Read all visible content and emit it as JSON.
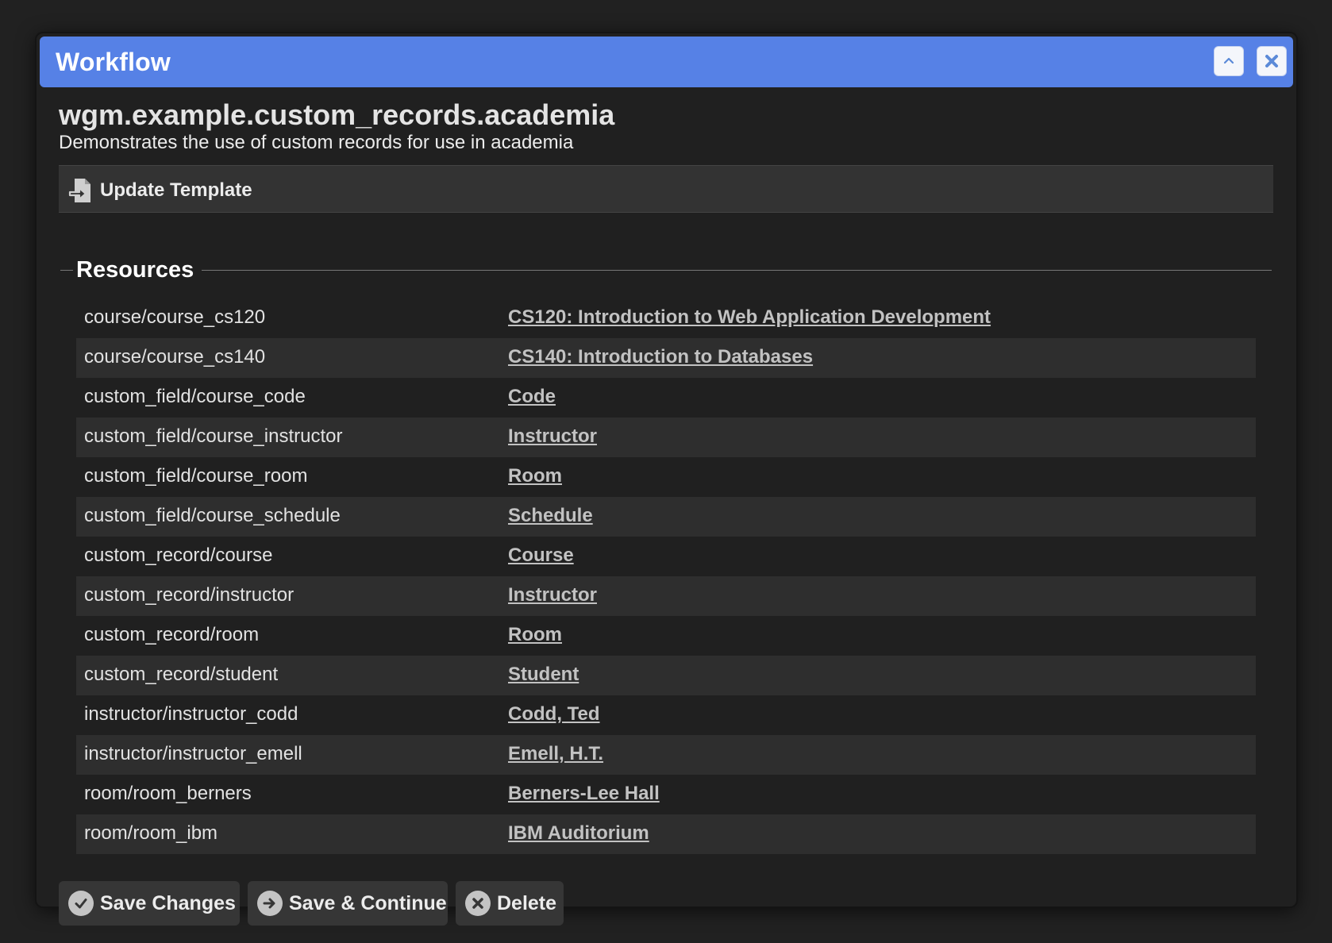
{
  "window": {
    "title": "Workflow"
  },
  "header": {
    "title": "wgm.example.custom_records.academia",
    "description": "Demonstrates the use of custom records for use in academia"
  },
  "toolbar": {
    "update_template_label": "Update Template"
  },
  "resources": {
    "title": "Resources",
    "rows": [
      {
        "key": "course/course_cs120",
        "value": "CS120: Introduction to Web Application Development"
      },
      {
        "key": "course/course_cs140",
        "value": "CS140: Introduction to Databases"
      },
      {
        "key": "custom_field/course_code",
        "value": "Code"
      },
      {
        "key": "custom_field/course_instructor",
        "value": "Instructor"
      },
      {
        "key": "custom_field/course_room",
        "value": "Room"
      },
      {
        "key": "custom_field/course_schedule",
        "value": "Schedule"
      },
      {
        "key": "custom_record/course",
        "value": "Course"
      },
      {
        "key": "custom_record/instructor",
        "value": "Instructor"
      },
      {
        "key": "custom_record/room",
        "value": "Room"
      },
      {
        "key": "custom_record/student",
        "value": "Student"
      },
      {
        "key": "instructor/instructor_codd",
        "value": "Codd, Ted"
      },
      {
        "key": "instructor/instructor_emell",
        "value": "Emell, H.T."
      },
      {
        "key": "room/room_berners",
        "value": "Berners-Lee Hall"
      },
      {
        "key": "room/room_ibm",
        "value": "IBM Auditorium"
      }
    ]
  },
  "footer": {
    "save_changes_label": "Save Changes",
    "save_continue_label": "Save & Continue",
    "delete_label": "Delete"
  },
  "colors": {
    "titlebar": "#5681e6",
    "background": "#202020",
    "link": "#c2c2c2"
  },
  "icons": {
    "collapse": "chevron-up-icon",
    "close": "close-icon",
    "update_template": "file-import-icon",
    "save_changes": "check-circle-icon",
    "save_continue": "arrow-right-circle-icon",
    "delete": "x-circle-icon"
  }
}
